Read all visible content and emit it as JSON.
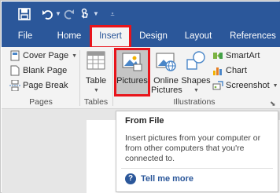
{
  "qat": {
    "icons": [
      "save-icon",
      "undo-icon",
      "redo-icon",
      "touch-mode-icon",
      "customize-qat-icon"
    ]
  },
  "tabs": {
    "file": "File",
    "home": "Home",
    "insert": "Insert",
    "design": "Design",
    "layout": "Layout",
    "references": "References"
  },
  "ribbon": {
    "pages": {
      "cover_page": "Cover Page",
      "blank_page": "Blank Page",
      "page_break": "Page Break",
      "group_label": "Pages"
    },
    "tables": {
      "table": "Table",
      "group_label": "Tables"
    },
    "illustrations": {
      "pictures": "Pictures",
      "online_pictures_line1": "Online",
      "online_pictures_line2": "Pictures",
      "shapes": "Shapes",
      "smartart": "SmartArt",
      "chart": "Chart",
      "screenshot": "Screenshot",
      "group_label": "Illustrations"
    }
  },
  "tooltip": {
    "title": "From File",
    "description": "Insert pictures from your computer or from other computers that you're connected to.",
    "help_link": "Tell me more"
  },
  "colors": {
    "title_bar": "#2b579a",
    "ribbon_bg": "#f3f3f3",
    "highlight": "#e8141b",
    "accent_text": "#2b579a"
  }
}
